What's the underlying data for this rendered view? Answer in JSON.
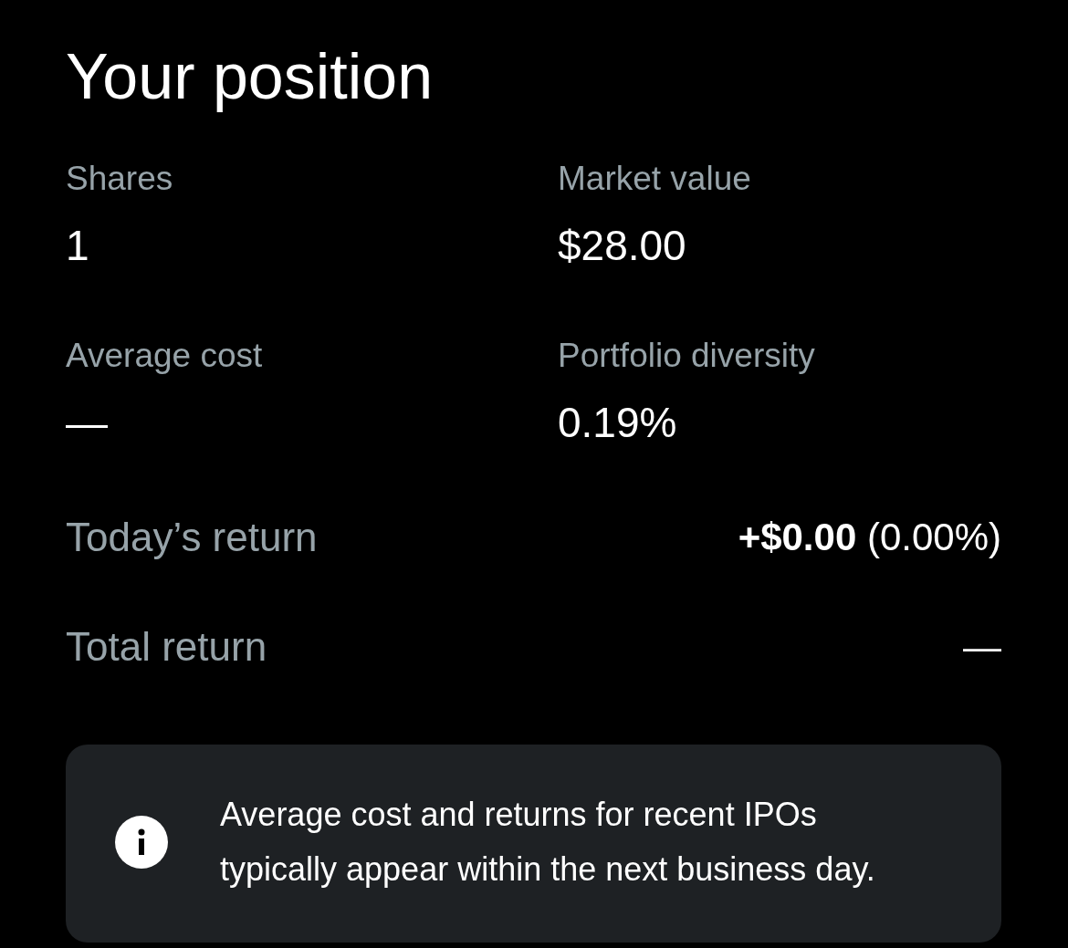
{
  "title": "Your position",
  "stats": [
    {
      "label": "Shares",
      "value": "1"
    },
    {
      "label": "Market value",
      "value": "$28.00"
    },
    {
      "label": "Average cost",
      "value": "—"
    },
    {
      "label": "Portfolio diversity",
      "value": "0.19%"
    }
  ],
  "returns": [
    {
      "label": "Today’s return",
      "value": "**+$0.00** (0.00%)"
    },
    {
      "label": "Total return",
      "value": "—"
    }
  ],
  "notice": {
    "text": "Average cost and returns for recent IPOs typically appear within the next business day."
  }
}
